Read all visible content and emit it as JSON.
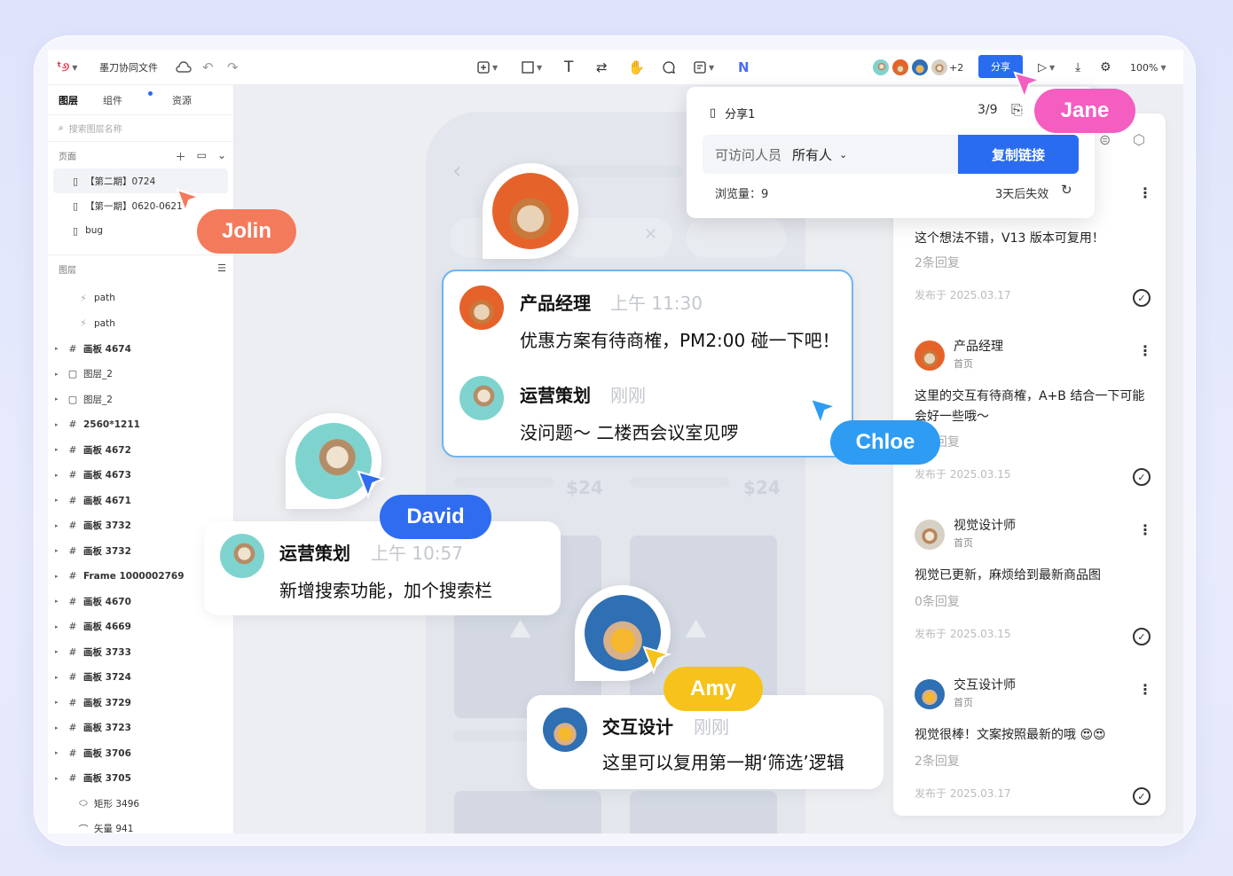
{
  "toolbar": {
    "file_title": "墨刀协同文件",
    "collaborators_extra": "+2",
    "share_label": "分享",
    "zoom": "100%"
  },
  "sidebar": {
    "tabs": [
      "图层",
      "组件",
      "资源"
    ],
    "search_placeholder": "搜索图层名称",
    "pages_header": "页面",
    "pages": [
      "【第二期】0724",
      "【第一期】0620-0621",
      "bug"
    ],
    "layers_header": "图层",
    "layers": [
      {
        "icon": "path",
        "label": "path",
        "expand": false
      },
      {
        "icon": "path",
        "label": "path",
        "expand": false
      },
      {
        "icon": "frame",
        "label": "画板 4674",
        "expand": true
      },
      {
        "icon": "rect",
        "label": "图层_2",
        "expand": true
      },
      {
        "icon": "rect",
        "label": "图层_2",
        "expand": true
      },
      {
        "icon": "frame",
        "label": "2560*1211",
        "expand": true
      },
      {
        "icon": "frame",
        "label": "画板 4672",
        "expand": true
      },
      {
        "icon": "frame",
        "label": "画板 4673",
        "expand": true
      },
      {
        "icon": "frame",
        "label": "画板 4671",
        "expand": true
      },
      {
        "icon": "frame",
        "label": "画板 3732",
        "expand": true
      },
      {
        "icon": "frame",
        "label": "画板 3732",
        "expand": true
      },
      {
        "icon": "frame",
        "label": "Frame 1000002769",
        "expand": true
      },
      {
        "icon": "frame",
        "label": "画板 4670",
        "expand": true
      },
      {
        "icon": "frame",
        "label": "画板 4669",
        "expand": true
      },
      {
        "icon": "frame",
        "label": "画板 3733",
        "expand": true
      },
      {
        "icon": "frame",
        "label": "画板 3724",
        "expand": true
      },
      {
        "icon": "frame",
        "label": "画板 3729",
        "expand": true
      },
      {
        "icon": "frame",
        "label": "画板 3723",
        "expand": true
      },
      {
        "icon": "frame",
        "label": "画板 3706",
        "expand": true
      },
      {
        "icon": "frame",
        "label": "画板 3705",
        "expand": true
      },
      {
        "icon": "ellipse",
        "label": "矩形 3496",
        "expand": false
      },
      {
        "icon": "vector",
        "label": "矢量 941",
        "expand": false
      }
    ]
  },
  "share_popover": {
    "share_name": "分享1",
    "page_count": "3/9",
    "access_label": "可访问人员",
    "access_value": "所有人",
    "copy_button": "复制链接",
    "views": "浏览量：9",
    "expiry": "3天后失效"
  },
  "comments": [
    {
      "author": "",
      "subtitle": "",
      "body": "这个想法不错，V13 版本可复用！",
      "replies": "2条回复",
      "date": "发布于 2025.03.17"
    },
    {
      "author": "产品经理",
      "subtitle": "首页",
      "body": "这里的交互有待商榷，A+B 结合一下可能会好一些哦～",
      "replies": "0条回复",
      "date": "发布于 2025.03.15"
    },
    {
      "author": "视觉设计师",
      "subtitle": "首页",
      "body": "视觉已更新，麻烦给到最新商品图",
      "replies": "0条回复",
      "date": "发布于 2025.03.15"
    },
    {
      "author": "交互设计师",
      "subtitle": "首页",
      "body": "视觉很棒！文案按照最新的哦 😍😍",
      "replies": "2条回复",
      "date": "发布于 2025.03.17"
    }
  ],
  "chat_main": {
    "msg1": {
      "name": "产品经理",
      "time": "上午 11:30",
      "text": "优惠方案有待商榷，PM2:00 碰一下吧！"
    },
    "msg2": {
      "name": "运营策划",
      "time": "刚刚",
      "text": "没问题～ 二楼西会议室见啰"
    }
  },
  "chat_david": {
    "name": "运营策划",
    "time": "上午 10:57",
    "text": "新增搜索功能，加个搜索栏"
  },
  "chat_amy": {
    "name": "交互设计",
    "time": "刚刚",
    "text": "这里可以复用第一期‘筛选’逻辑"
  },
  "canvas_prices": [
    "$24",
    "$24"
  ],
  "cursors": {
    "jolin": {
      "name": "Jolin",
      "color": "#f47a5c"
    },
    "jane": {
      "name": "Jane",
      "color": "#f45ec0"
    },
    "chloe": {
      "name": "Chloe",
      "color": "#2f9cf3"
    },
    "david": {
      "name": "David",
      "color": "#2f6cf0"
    },
    "amy": {
      "name": "Amy",
      "color": "#f7c21a"
    }
  }
}
